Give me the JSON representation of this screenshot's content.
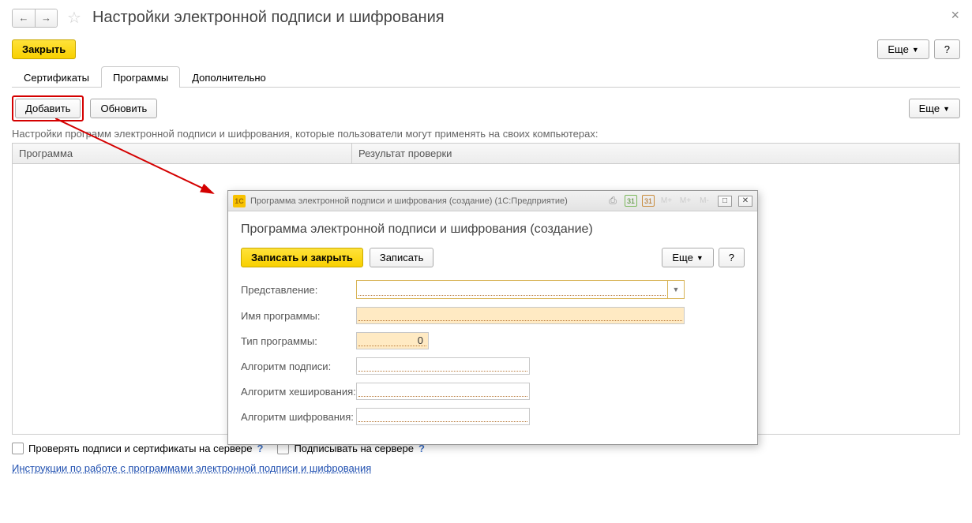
{
  "pageTitle": "Настройки электронной подписи и шифрования",
  "header": {
    "close": "Закрыть",
    "more": "Еще",
    "help": "?"
  },
  "tabs": {
    "certs": "Сертификаты",
    "programs": "Программы",
    "additional": "Дополнительно"
  },
  "toolbar": {
    "add": "Добавить",
    "refresh": "Обновить",
    "more": "Еще"
  },
  "hint": "Настройки программ электронной подписи и шифрования, которые пользователи могут применять на своих компьютерах:",
  "table": {
    "colProgram": "Программа",
    "colResult": "Результат проверки"
  },
  "bottom": {
    "checkServer": "Проверять подписи и сертификаты на сервере",
    "signServer": "Подписывать на сервере",
    "q": "?"
  },
  "link": "Инструкции по работе с программами электронной подписи и шифрования",
  "dialog": {
    "titlebar": "Программа электронной подписи и шифрования (создание)  (1С:Предприятие)",
    "icon1c": "1C",
    "cal1": "31",
    "cal2": "31",
    "m": "М+",
    "title": "Программа электронной подписи и шифрования (создание)",
    "saveClose": "Записать и закрыть",
    "save": "Записать",
    "more": "Еще",
    "help": "?",
    "fields": {
      "presentation": "Представление:",
      "programName": "Имя программы:",
      "programType": "Тип программы:",
      "programTypeValue": "0",
      "signAlg": "Алгоритм подписи:",
      "hashAlg": "Алгоритм хеширования:",
      "encAlg": "Алгоритм шифрования:"
    }
  }
}
